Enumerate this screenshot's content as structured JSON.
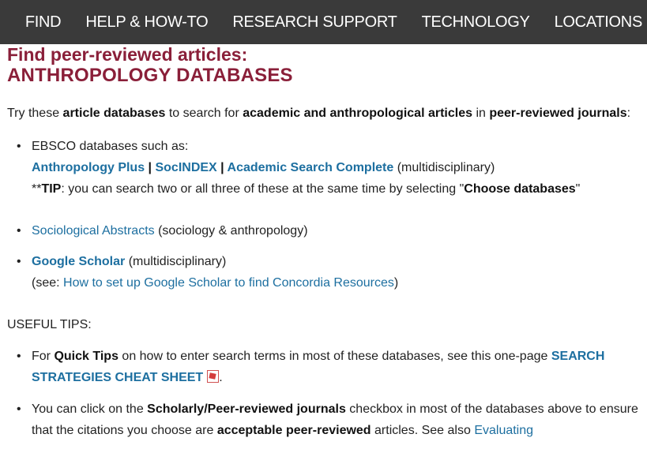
{
  "nav": [
    "FIND",
    "HELP & HOW-TO",
    "RESEARCH SUPPORT",
    "TECHNOLOGY",
    "LOCATIONS"
  ],
  "heading": {
    "line1": "Find peer-reviewed articles:",
    "line2": "ANTHROPOLOGY DATABASES"
  },
  "intro": {
    "t1": "Try these ",
    "b1": "article databases",
    "t2": " to search for ",
    "b2": "academic and anthropological articles",
    "t3": " in ",
    "b3": "peer-reviewed journals",
    "t4": ":"
  },
  "ebsco": {
    "lead": "EBSCO databases such as:",
    "link1": "Anthropology Plus",
    "sep": " | ",
    "link2": "SocINDEX",
    "link3": "Academic Search Complete",
    "note": " (multidisciplinary)",
    "tip_prefix": "**",
    "tip_label": "TIP",
    "tip_text": ":  you can search two or all three of these at the same time by selecting \"",
    "tip_bold": "Choose databases",
    "tip_end": "\""
  },
  "socabs": {
    "link": "Sociological Abstracts",
    "note": " (sociology & anthropology)"
  },
  "scholar": {
    "link": "Google Scholar",
    "note": "  (multidisciplinary)",
    "see": "(see: ",
    "setup_link": "How to set up Google Scholar to find Concordia Resources",
    "close": ")"
  },
  "tips_heading": "USEFUL TIPS:",
  "tip1": {
    "t1": "For ",
    "b1": "Quick Tips",
    "t2": " on how to enter search terms in most of these databases, see this one-page ",
    "link": "SEARCH STRATEGIES CHEAT SHEET",
    "end": "."
  },
  "tip2": {
    "t1": "You can click on the ",
    "b1": "Scholarly/Peer-reviewed journals",
    "t2": " checkbox in most of the databases above to ensure that the citations you choose are ",
    "b2": "acceptable peer-reviewed",
    "t3": " articles. See also ",
    "link": "Evaluating"
  },
  "icons": {
    "pdf": "pdf-icon"
  },
  "colors": {
    "nav_bg": "#3a3a3a",
    "heading": "#8a1f39",
    "link": "#1d6fa0"
  }
}
